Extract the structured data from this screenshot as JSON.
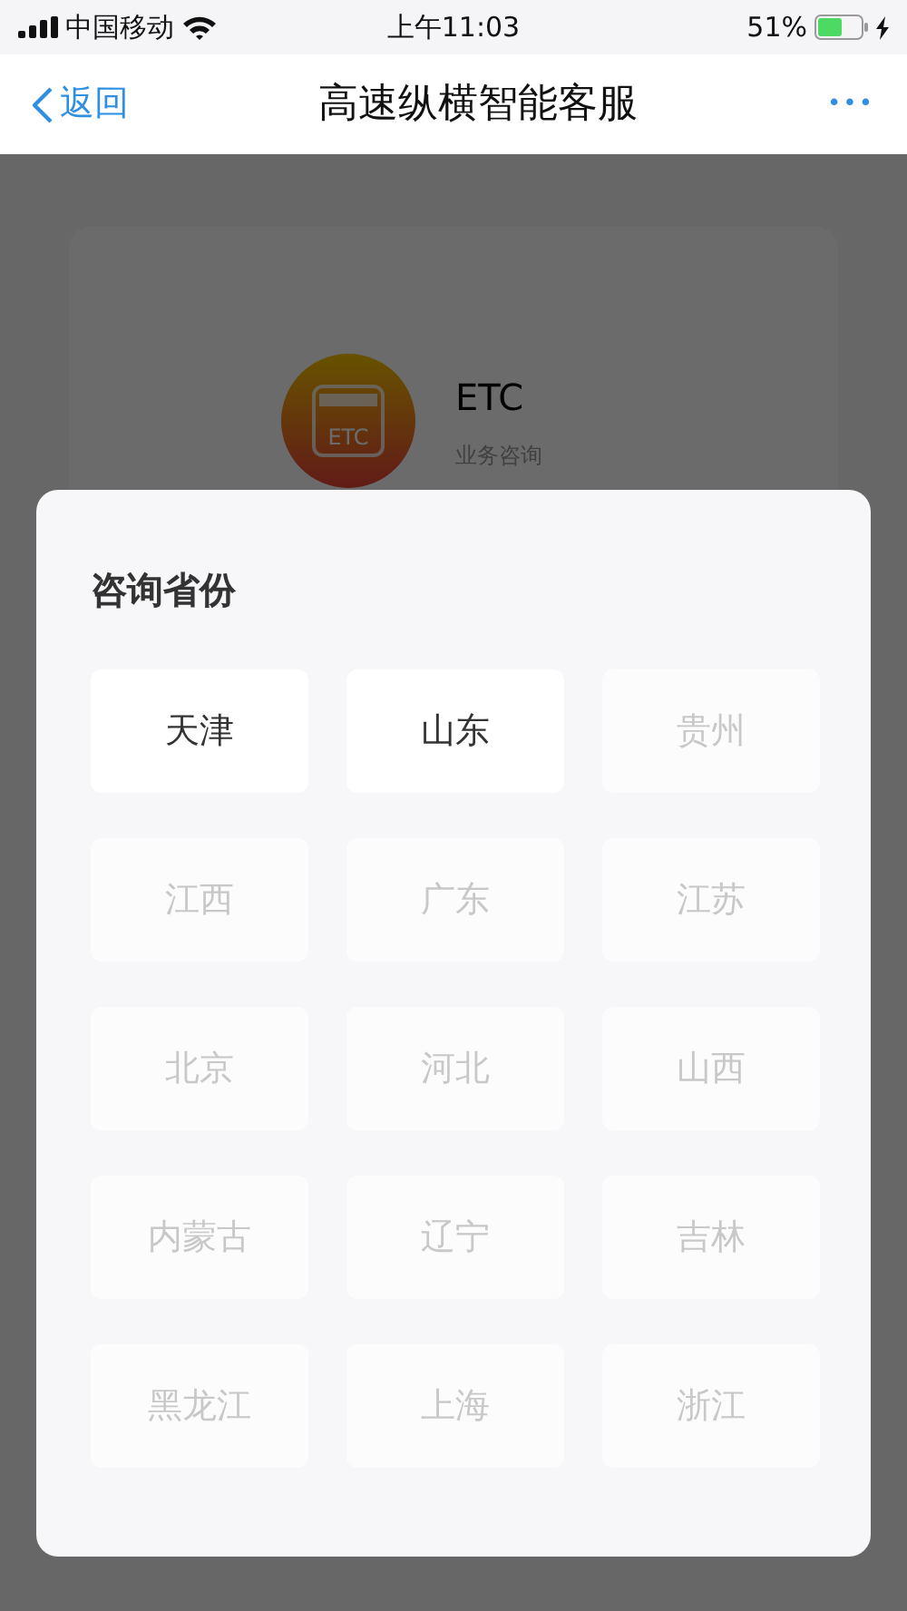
{
  "status_bar": {
    "carrier": "中国移动",
    "time": "上午11:03",
    "battery": "51%"
  },
  "nav": {
    "back": "返回",
    "title": "高速纵横智能客服",
    "more": "•••"
  },
  "service_card": {
    "icon_label": "ETC",
    "name": "ETC",
    "subtitle": "业务咨询"
  },
  "sheet": {
    "title": "咨询省份",
    "provinces": [
      {
        "label": "天津",
        "disabled": false
      },
      {
        "label": "山东",
        "disabled": false
      },
      {
        "label": "贵州",
        "disabled": true
      },
      {
        "label": "江西",
        "disabled": true
      },
      {
        "label": "广东",
        "disabled": true
      },
      {
        "label": "江苏",
        "disabled": true
      },
      {
        "label": "北京",
        "disabled": true
      },
      {
        "label": "河北",
        "disabled": true
      },
      {
        "label": "山西",
        "disabled": true
      },
      {
        "label": "内蒙古",
        "disabled": true
      },
      {
        "label": "辽宁",
        "disabled": true
      },
      {
        "label": "吉林",
        "disabled": true
      },
      {
        "label": "黑龙江",
        "disabled": true
      },
      {
        "label": "上海",
        "disabled": true
      },
      {
        "label": "浙江",
        "disabled": true
      }
    ]
  }
}
